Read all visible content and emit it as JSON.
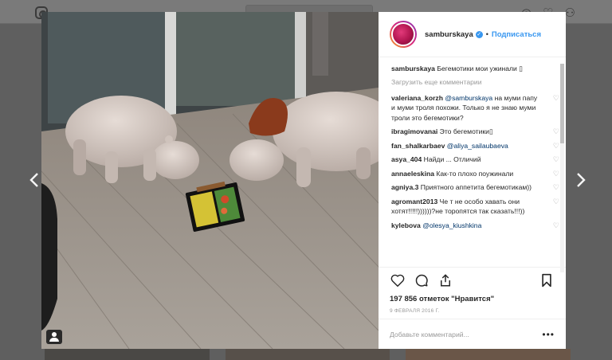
{
  "post": {
    "username": "samburskaya",
    "follow_label": "Подписаться",
    "separator": "•",
    "caption_user": "samburskaya",
    "caption_text": "Бегемотики мои ужинали ▯",
    "load_more": "Загрузить еще комментарии",
    "likes_count": "197 856 отметок",
    "likes_suffix": "\"Нравится\"",
    "date": "9 ФЕВРАЛЯ 2016 Г.",
    "add_comment_placeholder": "Добавьте комментарий...",
    "more_label": "•••"
  },
  "comments": [
    {
      "user": "valeriana_korzh",
      "mention": "@samburskaya",
      "text": " на муми папу и муми троля похожи. Только я не знаю муми троли это бегемотики?"
    },
    {
      "user": "ibragimovanai",
      "mention": "",
      "text": "Это бегемотики▯"
    },
    {
      "user": "fan_shalkarbaev",
      "mention": "@aliya_sailaubaeva",
      "text": ""
    },
    {
      "user": "asya_404",
      "mention": "",
      "text": "Найди ... Отличий"
    },
    {
      "user": "annaeleskina",
      "mention": "",
      "text": "Как-то плохо поужинали"
    },
    {
      "user": "agniya.3",
      "mention": "",
      "text": "Приятного аппетита бегемотикам))"
    },
    {
      "user": "agromant2013",
      "mention": "",
      "text": "Че т не особо хавать они хотят!!!!!))))))?не торопятся так сказать!!!))"
    },
    {
      "user": "kylebova",
      "mention": "@olesya_kiushkina",
      "text": ""
    }
  ],
  "icons": {
    "arrow_left": "chevron-left-icon",
    "arrow_right": "chevron-right-icon",
    "heart": "heart-icon",
    "comment": "comment-icon",
    "share": "share-icon",
    "save": "bookmark-icon"
  },
  "colors": {
    "accent": "#3897f0",
    "text": "#262626",
    "muted": "#999999"
  }
}
